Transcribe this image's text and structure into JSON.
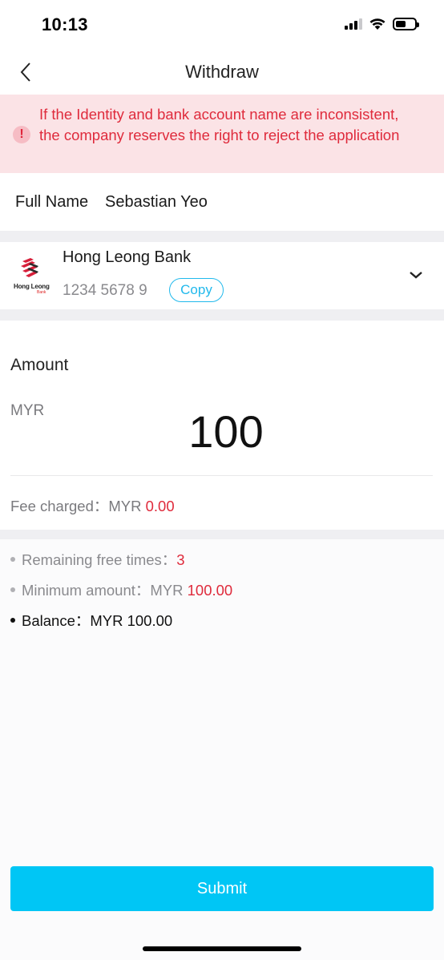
{
  "status_bar": {
    "time": "10:13",
    "icons": [
      "signal-icon",
      "wifi-icon",
      "battery-icon"
    ]
  },
  "nav": {
    "title": "Withdraw",
    "back_icon": "chevron-left-icon"
  },
  "warning": {
    "icon": "exclamation-icon",
    "symbol": "!",
    "text": "If the Identity and bank account name are inconsistent, the company reserves the right to reject the application",
    "color": "#df2b3c"
  },
  "full_name": {
    "label": "Full Name",
    "value": "Sebastian Yeo"
  },
  "bank": {
    "logo_text": "Hong Leong",
    "logo_sub": "Bank",
    "name": "Hong Leong Bank",
    "account": "1234 5678 9",
    "copy_label": "Copy",
    "dropdown_icon": "chevron-down-icon"
  },
  "amount": {
    "label": "Amount",
    "currency": "MYR",
    "value": "100",
    "fee_label": "Fee charged：",
    "fee_currency": "MYR ",
    "fee_value": "0.00"
  },
  "info": {
    "remaining_label": "Remaining free times：",
    "remaining_value": "3",
    "minimum_label": "Minimum amount：",
    "minimum_currency": "MYR ",
    "minimum_value": "100.00",
    "balance_label": "Balance：",
    "balance_value": "MYR 100.00"
  },
  "submit_label": "Submit",
  "colors": {
    "accent": "#00c6f5",
    "link": "#21b9ec",
    "danger": "#df2b3c",
    "warning_bg": "#fbe3e6"
  }
}
